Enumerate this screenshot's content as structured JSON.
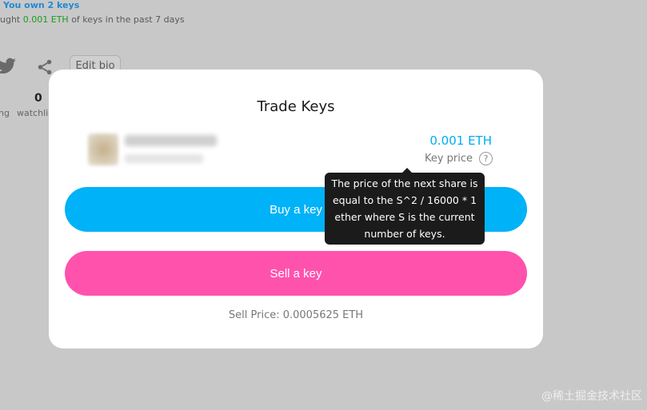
{
  "background": {
    "keys_owned_text": "You own 2 keys",
    "bought_prefix": "ught",
    "bought_amount": "0.001 ETH",
    "bought_suffix": "of keys in the past 7 days",
    "edit_bio_label": "Edit bio",
    "stat_count": "0",
    "stat_left_label": "ng",
    "stat_right_label": "watchlis"
  },
  "modal": {
    "title": "Trade Keys",
    "key_price_value": "0.001 ETH",
    "key_price_label": "Key price",
    "help_glyph": "?",
    "buy_label": "Buy a key",
    "sell_label": "Sell a key",
    "sell_price_text": "Sell Price: 0.0005625 ETH"
  },
  "tooltip": {
    "lines": [
      "The price of the next share is",
      "equal to the S^2 / 16000 * 1",
      "ether where S is the current",
      "number of keys."
    ]
  },
  "watermark": "@稀土掘金技术社区",
  "colors": {
    "accent_blue": "#00b2f7",
    "sell_pink": "#ff52ad",
    "eth_green": "#1c9b1c",
    "tooltip_bg": "#1b1b1b"
  },
  "icons": [
    "twitter-icon",
    "share-icon",
    "help-icon"
  ]
}
